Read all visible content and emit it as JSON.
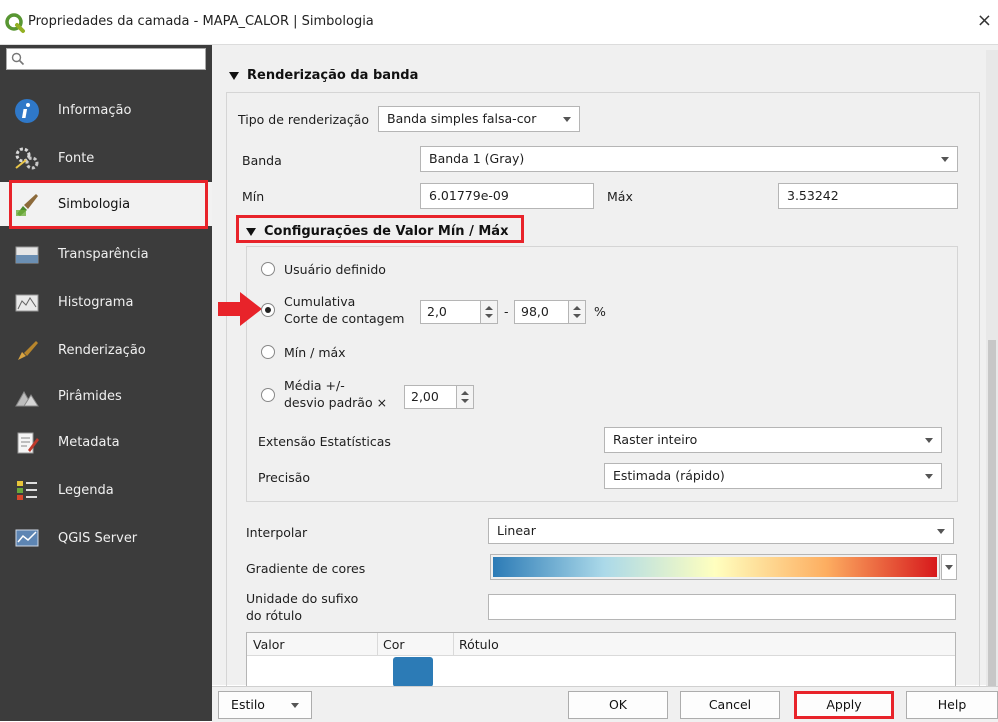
{
  "window": {
    "title": "Propriedades da camada - MAPA_CALOR | Simbologia",
    "close_glyph": "×"
  },
  "sidebar": {
    "search_placeholder": "",
    "items": [
      {
        "label": "Informação",
        "icon": "info-icon",
        "selected": false
      },
      {
        "label": "Fonte",
        "icon": "source-icon",
        "selected": false
      },
      {
        "label": "Simbologia",
        "icon": "paintbrush-icon",
        "selected": true
      },
      {
        "label": "Transparência",
        "icon": "transparency-icon",
        "selected": false
      },
      {
        "label": "Histograma",
        "icon": "histogram-icon",
        "selected": false
      },
      {
        "label": "Renderização",
        "icon": "rendering-icon",
        "selected": false
      },
      {
        "label": "Pirâmides",
        "icon": "pyramids-icon",
        "selected": false
      },
      {
        "label": "Metadata",
        "icon": "metadata-icon",
        "selected": false
      },
      {
        "label": "Legenda",
        "icon": "legend-icon",
        "selected": false
      },
      {
        "label": "QGIS Server",
        "icon": "server-icon",
        "selected": false
      }
    ]
  },
  "band_rendering": {
    "header": "Renderização da banda",
    "render_type_label": "Tipo de renderização",
    "render_type_value": "Banda simples falsa-cor",
    "band_label": "Banda",
    "band_value": "Banda 1 (Gray)",
    "min_label": "Mín",
    "min_value": "6.01779e-09",
    "max_label": "Máx",
    "max_value": "3.53242"
  },
  "minmax": {
    "header": "Configurações de Valor Mín / Máx",
    "user_defined": "Usuário definido",
    "cumulative_line1": "Cumulativa",
    "cumulative_line2": "Corte de contagem",
    "cumulative_low": "2,0",
    "dash": "-",
    "cumulative_high": "98,0",
    "percent": "%",
    "minmax_option": "Mín / máx",
    "mean_line1": "Média +/-",
    "mean_line2": "desvio padrão ×",
    "mean_value": "2,00",
    "extent_label": "Extensão Estatísticas",
    "extent_value": "Raster inteiro",
    "accuracy_label": "Precisão",
    "accuracy_value": "Estimada (rápido)"
  },
  "colormap": {
    "interpolate_label": "Interpolar",
    "interpolate_value": "Linear",
    "ramp_label": "Gradiente de cores",
    "suffix_label_line1": "Unidade do sufixo",
    "suffix_label_line2": "do rótulo",
    "suffix_value": "",
    "table_headers": [
      "Valor",
      "Cor",
      "Rótulo"
    ],
    "first_row_color": "#2c7bb6",
    "ramp_colors": [
      "#2c7bb6",
      "#abd9e9",
      "#ffffbf",
      "#fdae61",
      "#d7191c"
    ]
  },
  "footer": {
    "style_label": "Estilo",
    "ok_label": "OK",
    "cancel_label": "Cancel",
    "apply_label": "Apply",
    "help_label": "Help"
  },
  "colors": {
    "highlight_red": "#e8232a",
    "sidebar_bg": "#3c3c3c"
  }
}
